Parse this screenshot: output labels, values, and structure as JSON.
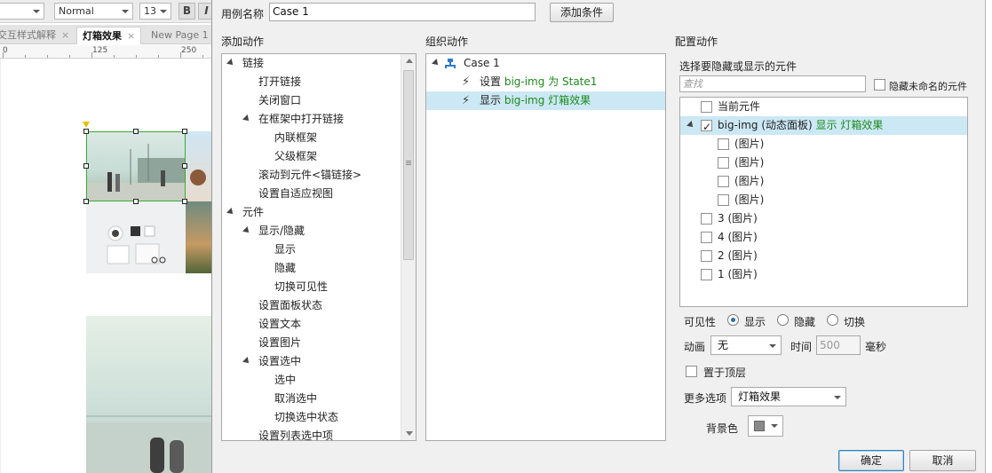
{
  "editor": {
    "toolbar": {
      "font_style": "Normal",
      "font_size": "13",
      "bold": "B",
      "italic": "I"
    },
    "tabs": [
      {
        "label": "交互样式解释",
        "close": "×"
      },
      {
        "label": "灯箱效果",
        "close": "×"
      },
      {
        "label": "New Page 1",
        "close": ""
      }
    ],
    "ruler": [
      "0",
      "125",
      "250"
    ]
  },
  "dialog": {
    "case_name_label": "用例名称",
    "case_name_value": "Case 1",
    "add_condition": "添加条件",
    "add_action_title": "添加动作",
    "organize_title": "组织动作",
    "configure_title": "配置动作",
    "actions_tree": [
      {
        "label": "链接",
        "indent": 0,
        "expander": "down"
      },
      {
        "label": "打开链接",
        "indent": 1,
        "expander": "right"
      },
      {
        "label": "关闭窗口",
        "indent": 1,
        "expander": "none"
      },
      {
        "label": "在框架中打开链接",
        "indent": 1,
        "expander": "down"
      },
      {
        "label": "内联框架",
        "indent": 2,
        "expander": "none"
      },
      {
        "label": "父级框架",
        "indent": 2,
        "expander": "none"
      },
      {
        "label": "滚动到元件<锚链接>",
        "indent": 1,
        "expander": "none"
      },
      {
        "label": "设置自适应视图",
        "indent": 1,
        "expander": "none"
      },
      {
        "label": "元件",
        "indent": 0,
        "expander": "down"
      },
      {
        "label": "显示/隐藏",
        "indent": 1,
        "expander": "down"
      },
      {
        "label": "显示",
        "indent": 2,
        "expander": "none"
      },
      {
        "label": "隐藏",
        "indent": 2,
        "expander": "none"
      },
      {
        "label": "切换可见性",
        "indent": 2,
        "expander": "none"
      },
      {
        "label": "设置面板状态",
        "indent": 1,
        "expander": "none"
      },
      {
        "label": "设置文本",
        "indent": 1,
        "expander": "none"
      },
      {
        "label": "设置图片",
        "indent": 1,
        "expander": "none"
      },
      {
        "label": "设置选中",
        "indent": 1,
        "expander": "down"
      },
      {
        "label": "选中",
        "indent": 2,
        "expander": "none"
      },
      {
        "label": "取消选中",
        "indent": 2,
        "expander": "none"
      },
      {
        "label": "切换选中状态",
        "indent": 2,
        "expander": "none"
      },
      {
        "label": "设置列表选中项",
        "indent": 1,
        "expander": "none"
      }
    ],
    "organize": {
      "case": "Case 1",
      "items": [
        {
          "prefix": "设置 ",
          "target": "big-img 为 State1"
        },
        {
          "prefix": "显示 ",
          "target": "big-img 灯箱效果"
        }
      ]
    },
    "configure": {
      "select_label": "选择要隐藏或显示的元件",
      "search_placeholder": "查找",
      "hide_unnamed": "隐藏未命名的元件",
      "widgets": [
        {
          "label": "当前元件",
          "extra": "",
          "checked": false,
          "indent": 0,
          "expander": "none",
          "selected": false
        },
        {
          "label": "big-img (动态面板) ",
          "extra": "显示 灯箱效果",
          "checked": true,
          "indent": 0,
          "expander": "down",
          "selected": true
        },
        {
          "label": "(图片)",
          "extra": "",
          "checked": false,
          "indent": 1,
          "expander": "none",
          "selected": false
        },
        {
          "label": "(图片)",
          "extra": "",
          "checked": false,
          "indent": 1,
          "expander": "none",
          "selected": false
        },
        {
          "label": "(图片)",
          "extra": "",
          "checked": false,
          "indent": 1,
          "expander": "none",
          "selected": false
        },
        {
          "label": "(图片)",
          "extra": "",
          "checked": false,
          "indent": 1,
          "expander": "none",
          "selected": false
        },
        {
          "label": "3 (图片)",
          "extra": "",
          "checked": false,
          "indent": 0,
          "expander": "none",
          "selected": false
        },
        {
          "label": "4 (图片)",
          "extra": "",
          "checked": false,
          "indent": 0,
          "expander": "none",
          "selected": false
        },
        {
          "label": "2 (图片)",
          "extra": "",
          "checked": false,
          "indent": 0,
          "expander": "none",
          "selected": false
        },
        {
          "label": "1 (图片)",
          "extra": "",
          "checked": false,
          "indent": 0,
          "expander": "none",
          "selected": false
        }
      ],
      "visibility_label": "可见性",
      "visibility_options": [
        "显示",
        "隐藏",
        "切换"
      ],
      "visibility_selected": "显示",
      "animation_label": "动画",
      "animation_value": "无",
      "time_label": "时间",
      "time_value": "500",
      "ms_label": "毫秒",
      "bring_to_front": "置于顶层",
      "more_options_label": "更多选项",
      "more_options_value": "灯箱效果",
      "bg_color_label": "背景色",
      "bg_color": "#8a8a8a"
    },
    "ok": "确定",
    "cancel": "取消"
  },
  "colors": {
    "selection": "#cce8f4",
    "action_green": "#1d8a1d",
    "primary_border": "#3c7fb1"
  }
}
